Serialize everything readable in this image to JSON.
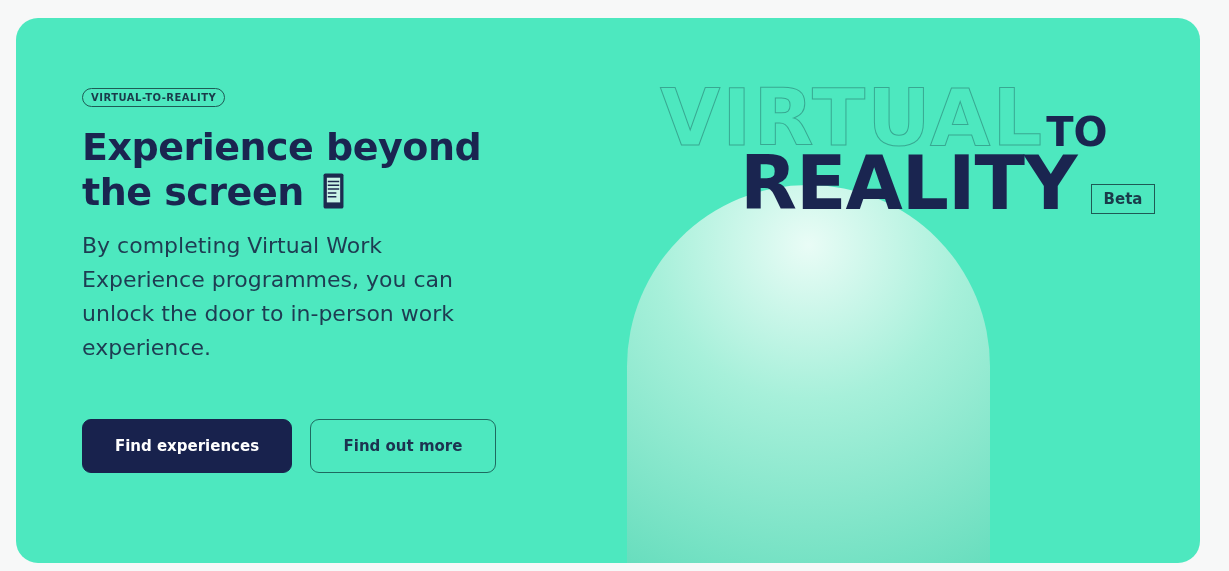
{
  "tag": "VIRTUAL-TO-REALITY",
  "heading_lines": [
    "Experience beyond",
    "the screen"
  ],
  "description": "By completing Virtual Work Experience programmes, you can unlock the door to in-person work experience.",
  "buttons": [
    {
      "label": "Find experiences",
      "kind": "primary"
    },
    {
      "label": "Find out more",
      "kind": "outline"
    }
  ],
  "logo": {
    "line_1": "VIRTUAL",
    "line_1_suffix": "TO",
    "line_2": "REALITY",
    "badge": "Beta"
  }
}
